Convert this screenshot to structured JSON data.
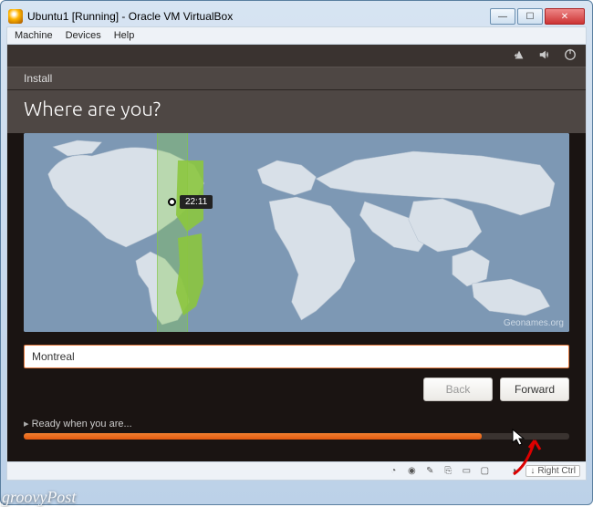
{
  "window": {
    "title": "Ubuntu1 [Running] - Oracle VM VirtualBox",
    "menubar": [
      "Machine",
      "Devices",
      "Help"
    ]
  },
  "installer": {
    "header": "Install",
    "question": "Where are you?",
    "map": {
      "time_label": "22:11",
      "credit": "Geonames.org"
    },
    "location_value": "Montreal",
    "buttons": {
      "back": "Back",
      "forward": "Forward"
    },
    "ready": "Ready when you are...",
    "progress_percent": 84
  },
  "vbox_status": {
    "host_key": "Right Ctrl"
  },
  "watermark": "groovyPost"
}
